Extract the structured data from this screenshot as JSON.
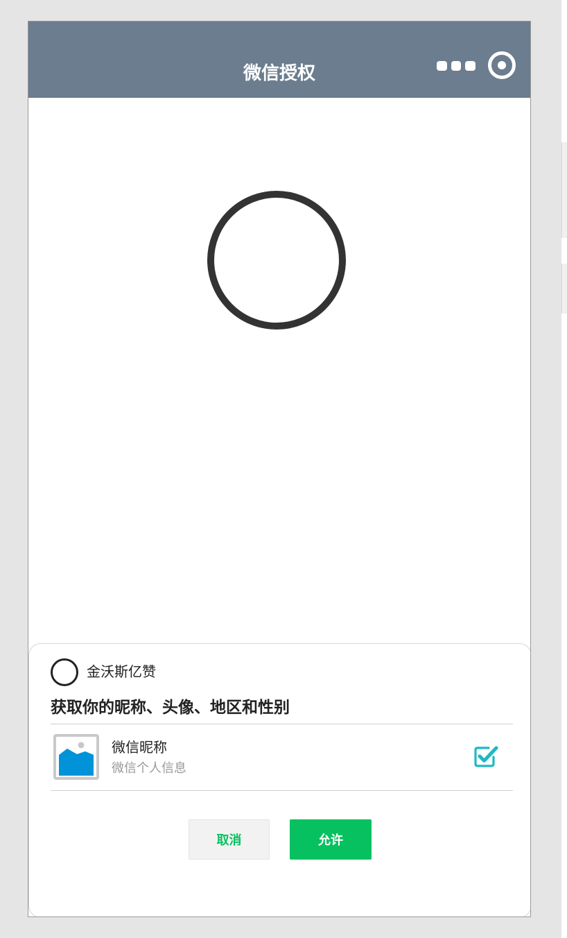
{
  "navbar": {
    "title": "微信授权",
    "background": "#6b7d8e",
    "icons": [
      "more-icon",
      "target-icon"
    ]
  },
  "main": {
    "spinner_icon": "circle-icon"
  },
  "sheet": {
    "app_name": "金沃斯亿赞",
    "permission_title": "获取你的昵称、头像、地区和性别",
    "item": {
      "title": "微信昵称",
      "subtitle": "微信个人信息",
      "checked": true,
      "avatar_icon": "image-placeholder-icon",
      "check_icon": "checkbox-checked-icon"
    },
    "buttons": {
      "cancel_label": "取消",
      "allow_label": "允许"
    }
  },
  "colors": {
    "accent_green": "#07c160",
    "check_teal": "#1db8c6",
    "image_blue": "#0093d8"
  }
}
